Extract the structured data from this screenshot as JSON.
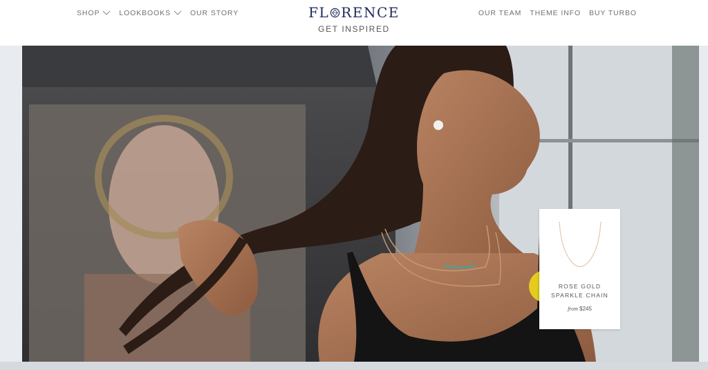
{
  "header": {
    "nav_left": [
      {
        "label": "SHOP",
        "has_dropdown": true
      },
      {
        "label": "LOOKBOOKS",
        "has_dropdown": true
      },
      {
        "label": "OUR STORY",
        "has_dropdown": false
      }
    ],
    "logo_left": "FL",
    "logo_right": "RENCE",
    "subtitle": "GET INSPIRED",
    "nav_right": [
      {
        "label": "OUR TEAM"
      },
      {
        "label": "THEME INFO"
      },
      {
        "label": "BUY TURBO"
      }
    ]
  },
  "product_card": {
    "name": "ROSE GOLD SPARKLE CHAIN",
    "price_prefix": "from",
    "price": "$245"
  },
  "colors": {
    "brand": "#1d2a5c",
    "nav_text": "#707070",
    "cursor_highlight": "#f0dc14"
  }
}
